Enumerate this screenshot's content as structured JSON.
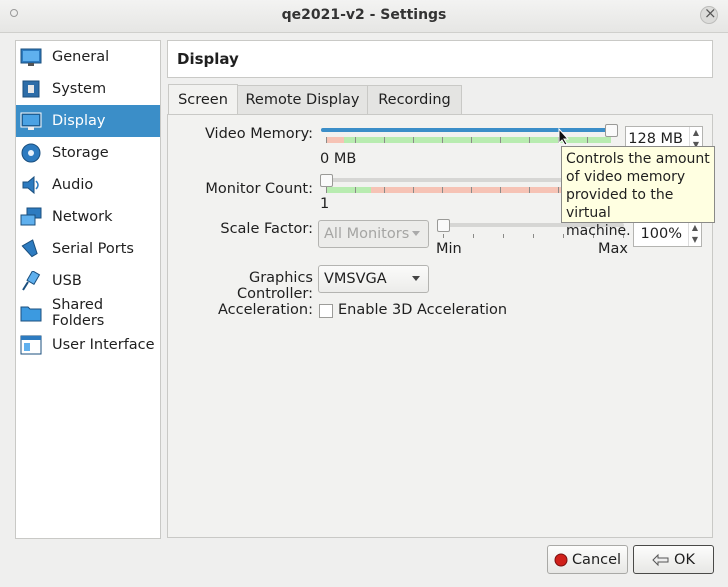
{
  "window": {
    "title": "qe2021-v2 - Settings"
  },
  "sidebar": {
    "items": [
      {
        "label": "General",
        "icon": "monitor-icon",
        "active": false
      },
      {
        "label": "System",
        "icon": "chip-icon",
        "active": false
      },
      {
        "label": "Display",
        "icon": "display-icon",
        "active": true
      },
      {
        "label": "Storage",
        "icon": "disk-icon",
        "active": false
      },
      {
        "label": "Audio",
        "icon": "speaker-icon",
        "active": false
      },
      {
        "label": "Network",
        "icon": "network-icon",
        "active": false
      },
      {
        "label": "Serial Ports",
        "icon": "serial-icon",
        "active": false
      },
      {
        "label": "USB",
        "icon": "usb-icon",
        "active": false
      },
      {
        "label": "Shared Folders",
        "icon": "folder-icon",
        "active": false
      },
      {
        "label": "User Interface",
        "icon": "ui-icon",
        "active": false
      }
    ]
  },
  "panel": {
    "title": "Display"
  },
  "tabs": [
    {
      "label": "Screen",
      "active": true
    },
    {
      "label": "Remote Display",
      "active": false
    },
    {
      "label": "Recording",
      "active": false
    }
  ],
  "screen": {
    "video_memory": {
      "label": "Video Memory:",
      "value": "128 MB",
      "min_label": "0 MB",
      "fill_fraction": 1.0
    },
    "monitor_count": {
      "label": "Monitor Count:",
      "min_label": "1",
      "fill_fraction": 0.0
    },
    "scale_factor": {
      "label": "Scale Factor:",
      "monitor_select": "All Monitors",
      "value": "100%",
      "min_label": "Min",
      "max_label": "Max",
      "fill_fraction": 0.0
    },
    "graphics_controller": {
      "label": "Graphics Controller:",
      "value": "VMSVGA"
    },
    "acceleration": {
      "label": "Acceleration:",
      "checkbox_label": "Enable 3D Acceleration",
      "checked": false
    }
  },
  "tooltip": {
    "lines": [
      "Controls the amount",
      "of video memory",
      "provided to the virtual",
      "machine."
    ]
  },
  "buttons": {
    "cancel": "Cancel",
    "ok": "OK"
  },
  "colors": {
    "accent": "#3b8ec8",
    "range_green": "#b8ecb0",
    "range_red": "#f6c3b5",
    "tooltip_bg": "#ffffe1"
  }
}
